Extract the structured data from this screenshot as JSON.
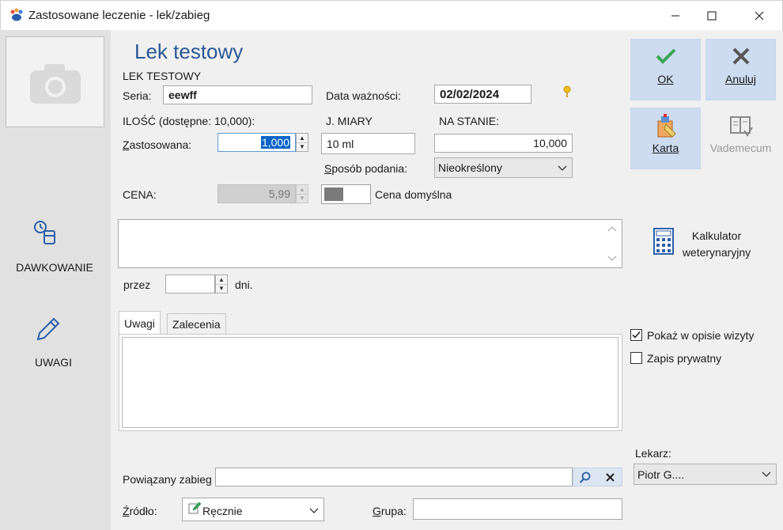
{
  "window": {
    "title": "Zastosowane leczenie - lek/zabieg"
  },
  "left": {
    "dosage_label": "DAWKOWANIE",
    "notes_label": "UWAGI"
  },
  "drug": {
    "name": "Lek testowy",
    "code": "LEK TESTOWY",
    "series_label": "Seria:",
    "series_value": "eewff",
    "expiry_label": "Data ważności:",
    "expiry_value": "02/02/2024",
    "qty_label": "ILOŚĆ (dostępne: 10,000):",
    "unit_label": "J. MIARY",
    "stock_label": "NA STANIE:",
    "applied_label": "Zastosowana:",
    "applied_value": "1,000",
    "unit_value": "10 ml",
    "stock_value": "10,000",
    "route_label": "Sposób podania:",
    "route_value": "Nieokreślony",
    "price_label": "CENA:",
    "price_value": "5,99",
    "default_price_label": "Cena domyślna"
  },
  "dosage": {
    "over_label": "przez",
    "days_value": "",
    "days_label": "dni."
  },
  "tabs": [
    {
      "label": "Uwagi"
    },
    {
      "label": "Zalecenia"
    }
  ],
  "options": {
    "show_in_visit_label": "Pokaż w opisie wizyty",
    "show_in_visit_checked": true,
    "private_label": "Zapis prywatny",
    "private_checked": false
  },
  "buttons": {
    "ok": "OK",
    "cancel": "Anuluj",
    "card": "Karta",
    "vademecum": "Vademecum",
    "calculator_line1": "Kalkulator",
    "calculator_line2": "weterynaryjny"
  },
  "doctor": {
    "label": "Lekarz:",
    "value": "Piotr G...."
  },
  "bottom": {
    "related_label": "Powiązany zabieg",
    "related_value": "",
    "source_label": "Źródło:",
    "source_value": "Ręcznie",
    "group_label": "Grupa:",
    "group_value": ""
  },
  "colors": {
    "accent_title": "#2b5797",
    "button_blue": "#cddcf0",
    "ok_check": "#3aa757"
  }
}
